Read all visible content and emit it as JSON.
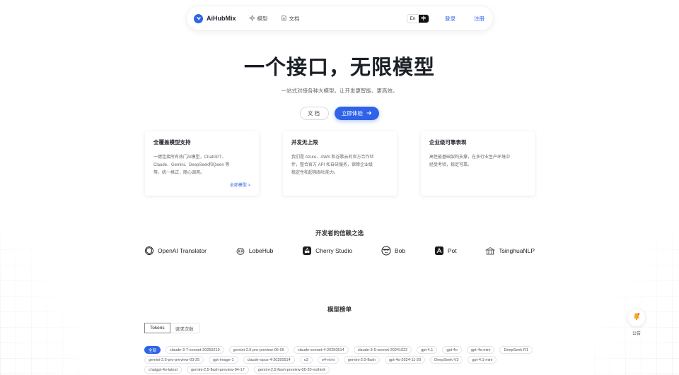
{
  "nav": {
    "brand": "AiHubMix",
    "links": [
      {
        "label": "模型",
        "icon": "sparkle-icon"
      },
      {
        "label": "文档",
        "icon": "doc-icon"
      }
    ],
    "lang_en": "En",
    "lang_zh": "中",
    "login": "登录",
    "register": "注册"
  },
  "hero": {
    "title": "一个接口，无限模型",
    "subtitle": "一站式对接各种大模型。让开发更智能、更高效。",
    "doc_button": "文档",
    "try_button": "立即体验"
  },
  "features": [
    {
      "title": "全覆盖模型支持",
      "body_lines": [
        "一键连接所有热门AI模型，ChatGPT、",
        "Claude、Gemini、DeepSeek和Qwen 等",
        "等，统一格式，随心调用。"
      ],
      "link": "全部模型 >"
    },
    {
      "title": "并发无上限",
      "body_lines": [
        "我们是 Azure、AWS 和谷歌云的官方合作伙",
        "伴，整合官方 API 和自研服务，保障企业级",
        "稳定性和超强吞吐能力。"
      ]
    },
    {
      "title": "企业级可靠表现",
      "body_lines": [
        "高性能基础架构支撑，在多行业生产环境中",
        "经受考验，稳定可靠。"
      ]
    }
  ],
  "trusted": {
    "title": "开发者的信赖之选",
    "partners": [
      {
        "name": "OpenAI Translator",
        "icon": "openai-icon"
      },
      {
        "name": "LobeHub",
        "icon": "lobehub-icon"
      },
      {
        "name": "Cherry Studio",
        "icon": "cherry-studio-icon"
      },
      {
        "name": "Bob",
        "icon": "bob-icon"
      },
      {
        "name": "Pot",
        "icon": "pot-icon"
      },
      {
        "name": "TsinghuaNLP",
        "icon": "tsinghua-icon"
      }
    ]
  },
  "leaderboard": {
    "title": "模型榜单",
    "tabs": [
      "Tokens",
      "请求次数"
    ],
    "tags": [
      "全部",
      "claude-3-7-sonnet-20250219",
      "gemini-2.5-pro-preview-05-06",
      "claude-sonnet-4-20250514",
      "claude-3-5-sonnet-20241022",
      "gpt-4.1",
      "gpt-4o",
      "gpt-4o-mini",
      "DeepSeek-R1",
      "gemini-2.5-pro-preview-03-25",
      "gpt-image-1",
      "claude-opus-4-20250514",
      "o3",
      "o4-mini",
      "gemini-2.0-flash",
      "gpt-4o-2024-11-20",
      "DeepSeek-V3",
      "gpt-4.1-mini",
      "chatgpt-4o-latest",
      "gemini-2.5-flash-preview-04-17",
      "gemini-2.5-flash-preview-05-20-nothink"
    ]
  },
  "notice": {
    "label": "公告"
  },
  "colors": {
    "accent": "#2f63e8",
    "text": "#1f2329"
  }
}
